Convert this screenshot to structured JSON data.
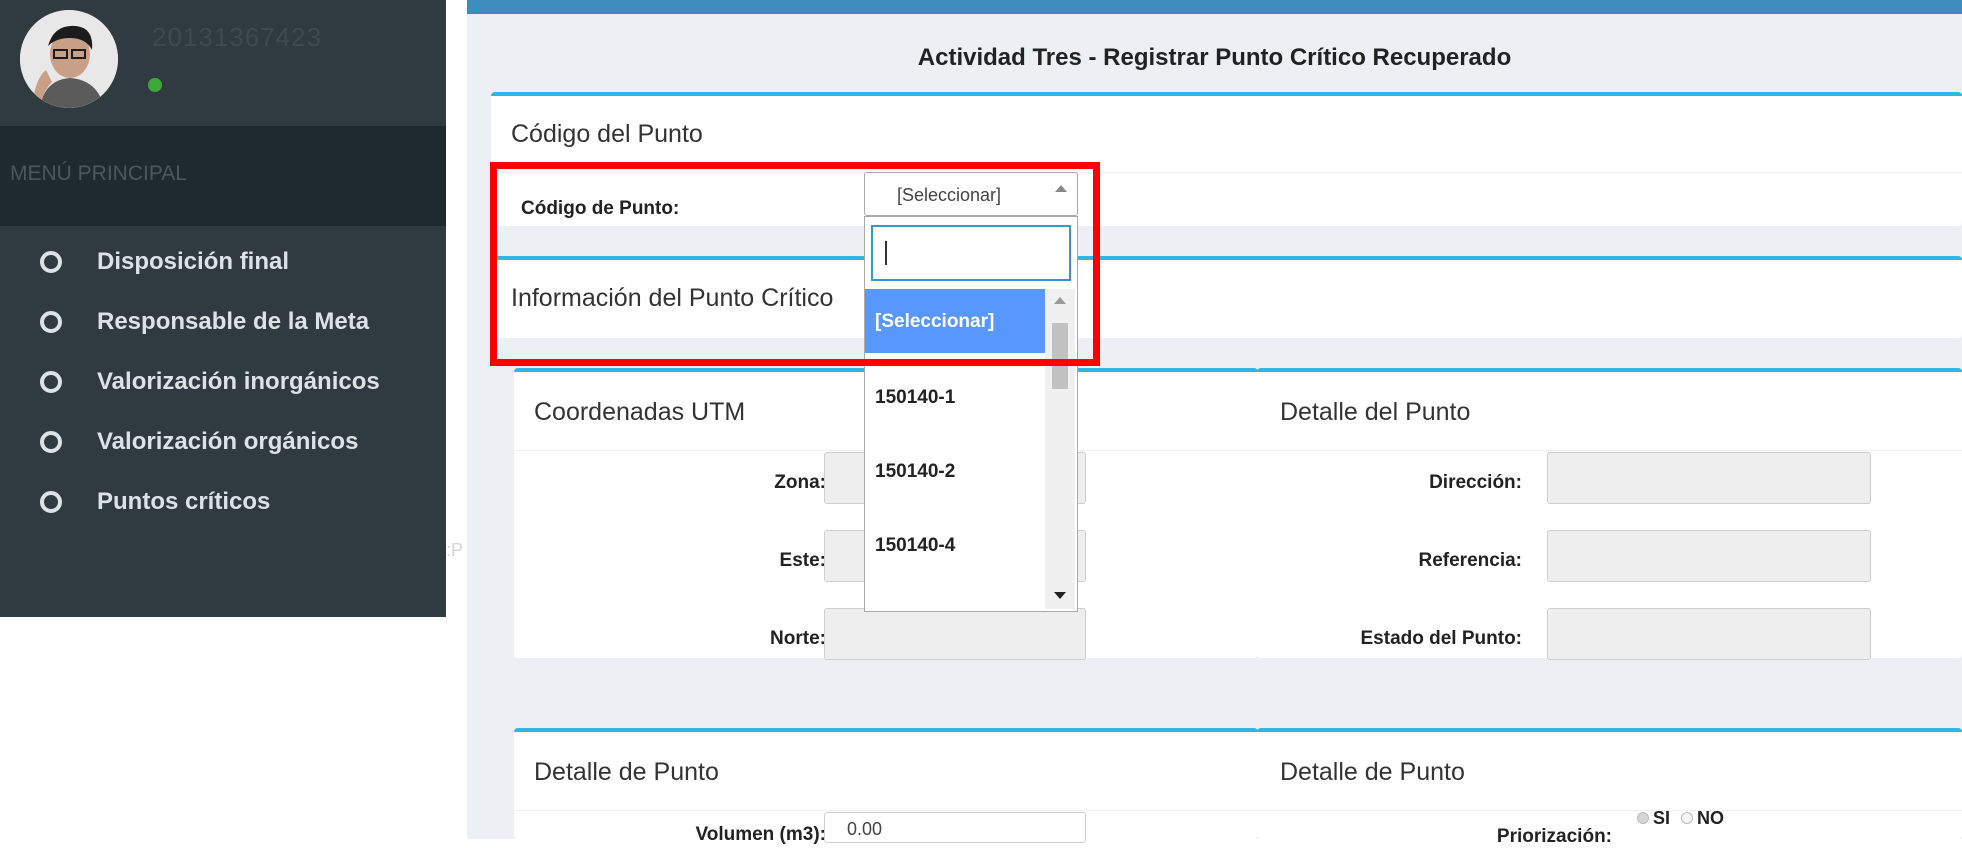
{
  "user": {
    "id": "20131367423"
  },
  "sidebar": {
    "menu_header": "MENÚ PRINCIPAL",
    "items": [
      {
        "label": "Disposición final"
      },
      {
        "label": "Responsable de la Meta"
      },
      {
        "label": "Valorización inorgánicos"
      },
      {
        "label": "Valorización orgánicos"
      },
      {
        "label": "Puntos críticos"
      }
    ],
    "overflow_text": ":P"
  },
  "page": {
    "title": "Actividad Tres - Registrar Punto Crítico Recuperado"
  },
  "codigo_box": {
    "title": "Código del Punto",
    "label": "Código de Punto:",
    "select_value": "[Seleccionar]"
  },
  "dropdown": {
    "search_value": "",
    "options": [
      "[Seleccionar]",
      "150140-1",
      "150140-2",
      "150140-4"
    ],
    "selected_index": 0
  },
  "info_box": {
    "title": "Información del Punto Crítico"
  },
  "utm_box": {
    "title": "Coordenadas UTM",
    "fields": [
      {
        "label": "Zona:",
        "value": ""
      },
      {
        "label": "Este:",
        "value": ""
      },
      {
        "label": "Norte:",
        "value": ""
      }
    ]
  },
  "detalle_punto_box": {
    "title": "Detalle del Punto",
    "fields": [
      {
        "label": "Dirección:",
        "value": ""
      },
      {
        "label": "Referencia:",
        "value": ""
      },
      {
        "label": "Estado del Punto:",
        "value": ""
      }
    ]
  },
  "detalle_volumen_box": {
    "title": "Detalle de Punto",
    "label": "Volumen (m3):",
    "value": "0.00"
  },
  "detalle_priorizacion_box": {
    "title": "Detalle de Punto",
    "label": "Priorización:",
    "options": [
      {
        "label": "SI",
        "checked": true
      },
      {
        "label": "NO",
        "checked": false
      }
    ]
  },
  "colors": {
    "sidebar_bg": "#2f3b40",
    "menu_header_bg": "#1f2a2e",
    "topbar": "#3c8dbc",
    "box_accent": "#2fb6e6",
    "dropdown_selected": "#5897fb",
    "highlight": "#ff0000",
    "online": "#3fa83a"
  }
}
